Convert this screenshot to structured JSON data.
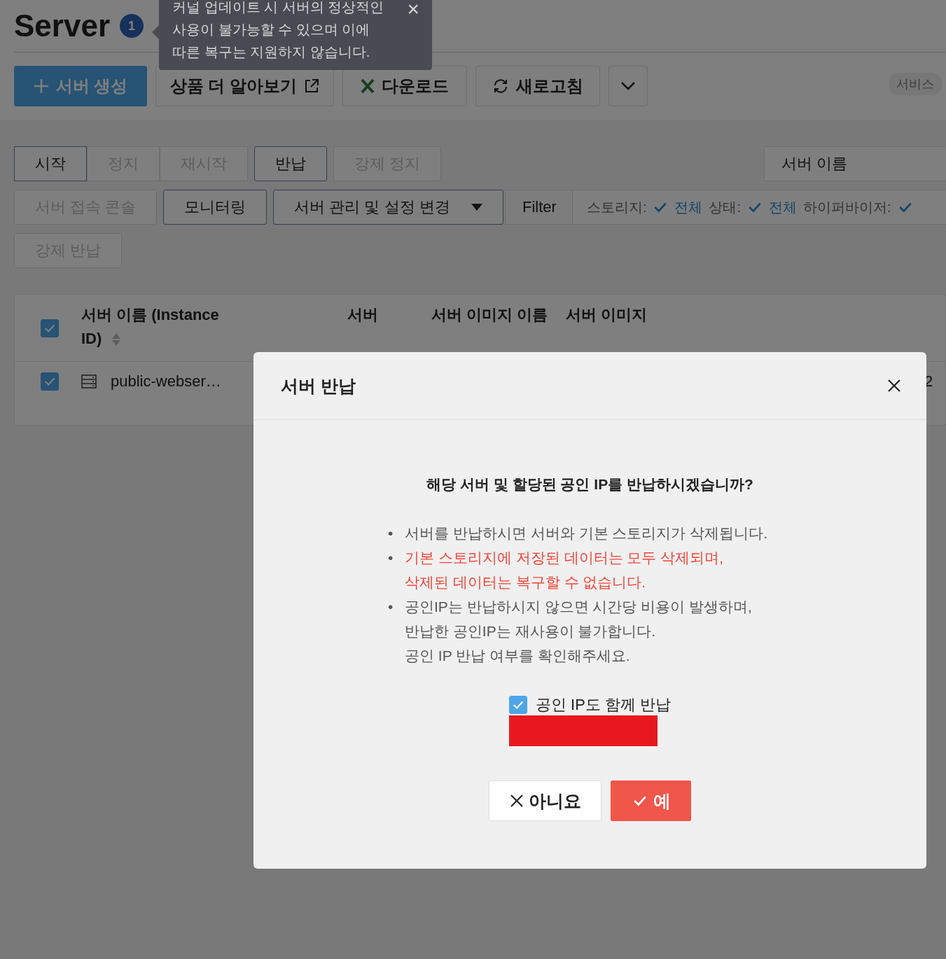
{
  "header": {
    "title": "Server",
    "badge": "1"
  },
  "tooltip": {
    "lines": [
      "커널 업데이트 시 서버의 정상적인",
      "사용이 불가능할 수 있으며 이에",
      "따른 복구는 지원하지 않습니다."
    ],
    "close": "×"
  },
  "toolbar": [
    {
      "label": "서버 생성",
      "kind": "primary"
    },
    {
      "label": "상품 더 알아보기",
      "kind": "external"
    },
    {
      "label": "다운로드",
      "kind": "excel"
    },
    {
      "label": "새로고침",
      "kind": "refresh"
    },
    {
      "kind": "caret"
    }
  ],
  "service_tag": "서비스",
  "action_rows": [
    [
      {
        "label": "시작",
        "disabled": false,
        "group": true
      },
      {
        "label": "정지",
        "disabled": true,
        "group": true
      },
      {
        "label": "재시작",
        "disabled": true,
        "group": true
      },
      {
        "label": "반납",
        "disabled": false,
        "group": false
      },
      {
        "label": "강제 정지",
        "disabled": true,
        "group": false
      }
    ],
    [
      {
        "label": "서버 접속 콘솔",
        "disabled": true,
        "group": false
      },
      {
        "label": "모니터링",
        "disabled": false,
        "group": false
      },
      {
        "label": "서버 관리 및 설정 변경",
        "disabled": false,
        "group": false,
        "dropdown": true
      }
    ],
    [
      {
        "label": "강제 반납",
        "disabled": true,
        "group": false
      }
    ]
  ],
  "search": {
    "placeholder": "서버 이름"
  },
  "filter": {
    "label": "Filter",
    "items": [
      {
        "label": "스토리지:",
        "value": "전체"
      },
      {
        "label": "상태:",
        "value": "전체"
      },
      {
        "label": "하이퍼바이저:",
        "value": ""
      }
    ]
  },
  "table": {
    "select_all_checked": true,
    "columns": [
      {
        "label": "서버 이름 (Instance ID)",
        "sortable": true
      },
      {
        "label": "서버",
        "sortable": false
      },
      {
        "label": "서버 이미지 이름",
        "sortable": false
      },
      {
        "label": "서버 이미지",
        "sortable": false
      }
    ],
    "rows": [
      {
        "checked": true,
        "name": "public-webser…",
        "column_last": "2"
      }
    ]
  },
  "dialog": {
    "title": "서버 반납",
    "question": "해당 서버 및 할당된 공인 IP를 반납하시겠습니까?",
    "bullets": [
      {
        "kind": "normal",
        "marker": "•",
        "lines": [
          "서버를 반납하시면 서버와 기본 스토리지가 삭제됩니다."
        ]
      },
      {
        "kind": "warning",
        "marker": "•",
        "lines": [
          "기본 스토리지에 저장된 데이터는 모두 삭제되며,",
          "삭제된 데이터는 복구할 수 없습니다."
        ]
      },
      {
        "kind": "normal",
        "marker": "•",
        "lines": [
          "공인IP는 반납하시지 않으면 시간당 비용이 발생하며,",
          "반납한 공인IP는 재사용이 불가합니다.",
          "공인 IP 반납 여부를 확인해주세요."
        ]
      }
    ],
    "checkbox": {
      "label": "공인 IP도 함께 반납",
      "checked": true
    },
    "cancel": "아니요",
    "confirm": "예"
  }
}
